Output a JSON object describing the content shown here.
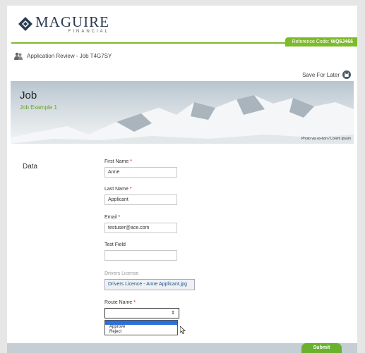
{
  "brand": {
    "name": "MAGUIRE",
    "sub": "FINANCIAL"
  },
  "reference": {
    "prefix": "Reference Code: ",
    "code": "WQ6J466"
  },
  "breadcrumb": {
    "label": "Application Review - Job T4G7SY"
  },
  "toolbar": {
    "save_label": "Save For Later"
  },
  "banner": {
    "title": "Job",
    "subtitle": "Job Example 1",
    "credit": "Photo via ex-lion / Lorem ipsum"
  },
  "section": {
    "label": "Data"
  },
  "fields": {
    "first_name": {
      "label": "First Name",
      "required": "*",
      "value": "Anne"
    },
    "last_name": {
      "label": "Last Name",
      "required": "*",
      "value": "Applicant"
    },
    "email": {
      "label": "Email",
      "required": "*",
      "value": "testuser@ace.com"
    },
    "text_field": {
      "label": "Test Field",
      "value": ""
    },
    "drivers_license": {
      "label": "Drivers License",
      "file": "Drivers Licence - Anne Applicant.jpg"
    },
    "route_name": {
      "label": "Route Name",
      "required": "*",
      "value": "",
      "arrow": "⇕"
    }
  },
  "dropdown": {
    "options": [
      "",
      "Approve",
      "Reject"
    ]
  },
  "footer": {
    "submit_label": "Submit"
  },
  "colors": {
    "accent": "#7dba2c",
    "navy": "#2a3b52",
    "footer": "#c5cdd5"
  }
}
